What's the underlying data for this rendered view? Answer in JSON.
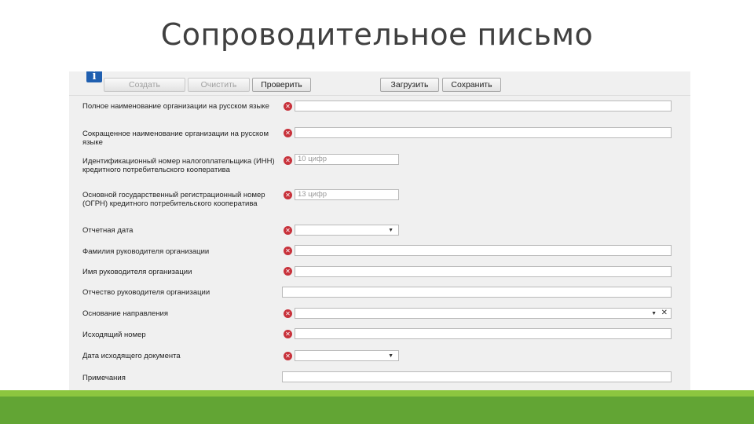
{
  "slide": {
    "title": "Сопроводительное письмо"
  },
  "toolbar": {
    "info_icon": "i",
    "create_label": "Создать",
    "clear_label": "Очистить",
    "check_label": "Проверить",
    "load_label": "Загрузить",
    "save_label": "Сохранить"
  },
  "form": {
    "rows": [
      {
        "label": "Полное наименование организации на русском языке",
        "value": "",
        "placeholder": ""
      },
      {
        "label": "Сокращенное наименование организации на русском языке",
        "value": "",
        "placeholder": ""
      },
      {
        "label": "Идентификационный номер налогоплательщика (ИНН) кредитного потребительского кооператива",
        "value": "",
        "placeholder": "10 цифр"
      },
      {
        "label": "Основной государственный регистрационный номер (ОГРН) кредитного потребительского кооператива",
        "value": "",
        "placeholder": "13 цифр"
      },
      {
        "label": "Отчетная дата",
        "value": "",
        "placeholder": ""
      },
      {
        "label": "Фамилия руководителя организации",
        "value": "",
        "placeholder": ""
      },
      {
        "label": "Имя руководителя организации",
        "value": "",
        "placeholder": ""
      },
      {
        "label": "Отчество руководителя организации",
        "value": "",
        "placeholder": ""
      },
      {
        "label": "Основание направления",
        "value": "",
        "placeholder": ""
      },
      {
        "label": "Исходящий номер",
        "value": "",
        "placeholder": ""
      },
      {
        "label": "Дата исходящего документа",
        "value": "",
        "placeholder": ""
      },
      {
        "label": "Примечания",
        "value": "",
        "placeholder": ""
      }
    ],
    "error_glyph": "✕",
    "dropdown_glyph": "▼",
    "clear_glyph": "✕"
  },
  "colors": {
    "error": "#c8323b",
    "accent_green": "#62a534",
    "light_green": "#8cc63f",
    "info_blue": "#1f5fb0"
  }
}
